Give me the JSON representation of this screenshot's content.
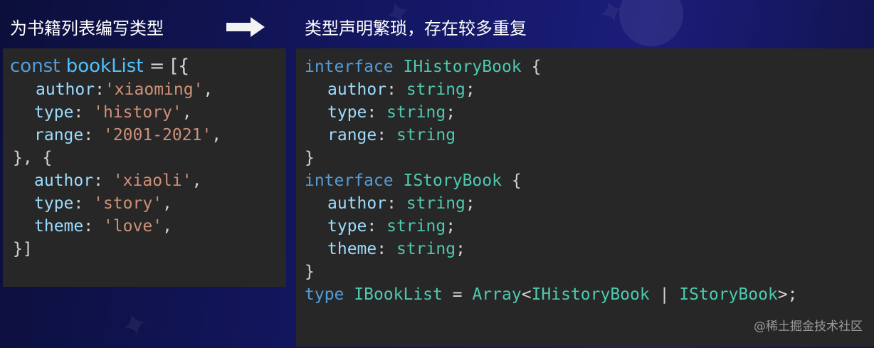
{
  "headings": {
    "left": "为书籍列表编写类型",
    "right": "类型声明繁琐，存在较多重复"
  },
  "left_code": {
    "line1": {
      "kw": "const",
      "var": "bookList",
      "eq": "=",
      "open": "[{"
    },
    "line2": {
      "key": "author",
      "colon": ":",
      "value": "'xiaoming'",
      "comma": ","
    },
    "line3": {
      "key": "type",
      "colon": ":",
      "value": "'history'",
      "comma": ","
    },
    "line4": {
      "key": "range",
      "colon": ":",
      "value": "'2001-2021'",
      "comma": ","
    },
    "line5": "}, {",
    "line6": {
      "key": "author",
      "colon": ":",
      "value": "'xiaoli'",
      "comma": ","
    },
    "line7": {
      "key": "type",
      "colon": ":",
      "value": "'story'",
      "comma": ","
    },
    "line8": {
      "key": "theme",
      "colon": ":",
      "value": "'love'",
      "comma": ","
    },
    "line9": "}]"
  },
  "right_code": {
    "iface1": {
      "kw": "interface",
      "name": "IHistoryBook",
      "open": "{"
    },
    "iface1_props": [
      {
        "key": "author",
        "colon": ":",
        "type": "string",
        "end": ";"
      },
      {
        "key": "type",
        "colon": ":",
        "type": "string",
        "end": ";"
      },
      {
        "key": "range",
        "colon": ":",
        "type": "string",
        "end": ""
      }
    ],
    "close1": "}",
    "iface2": {
      "kw": "interface",
      "name": "IStoryBook",
      "open": "{"
    },
    "iface2_props": [
      {
        "key": "author",
        "colon": ":",
        "type": "string",
        "end": ";"
      },
      {
        "key": "type",
        "colon": ":",
        "type": "string",
        "end": ";"
      },
      {
        "key": "theme",
        "colon": ":",
        "type": "string",
        "end": ";"
      }
    ],
    "close2": "}",
    "alias": {
      "kw": "type",
      "name": "IBookList",
      "eq": "=",
      "array": "Array",
      "lt": "<",
      "t1": "IHistoryBook",
      "pipe": "|",
      "t2": "IStoryBook",
      "gt": ">;"
    }
  },
  "watermark": "@稀土掘金技术社区"
}
